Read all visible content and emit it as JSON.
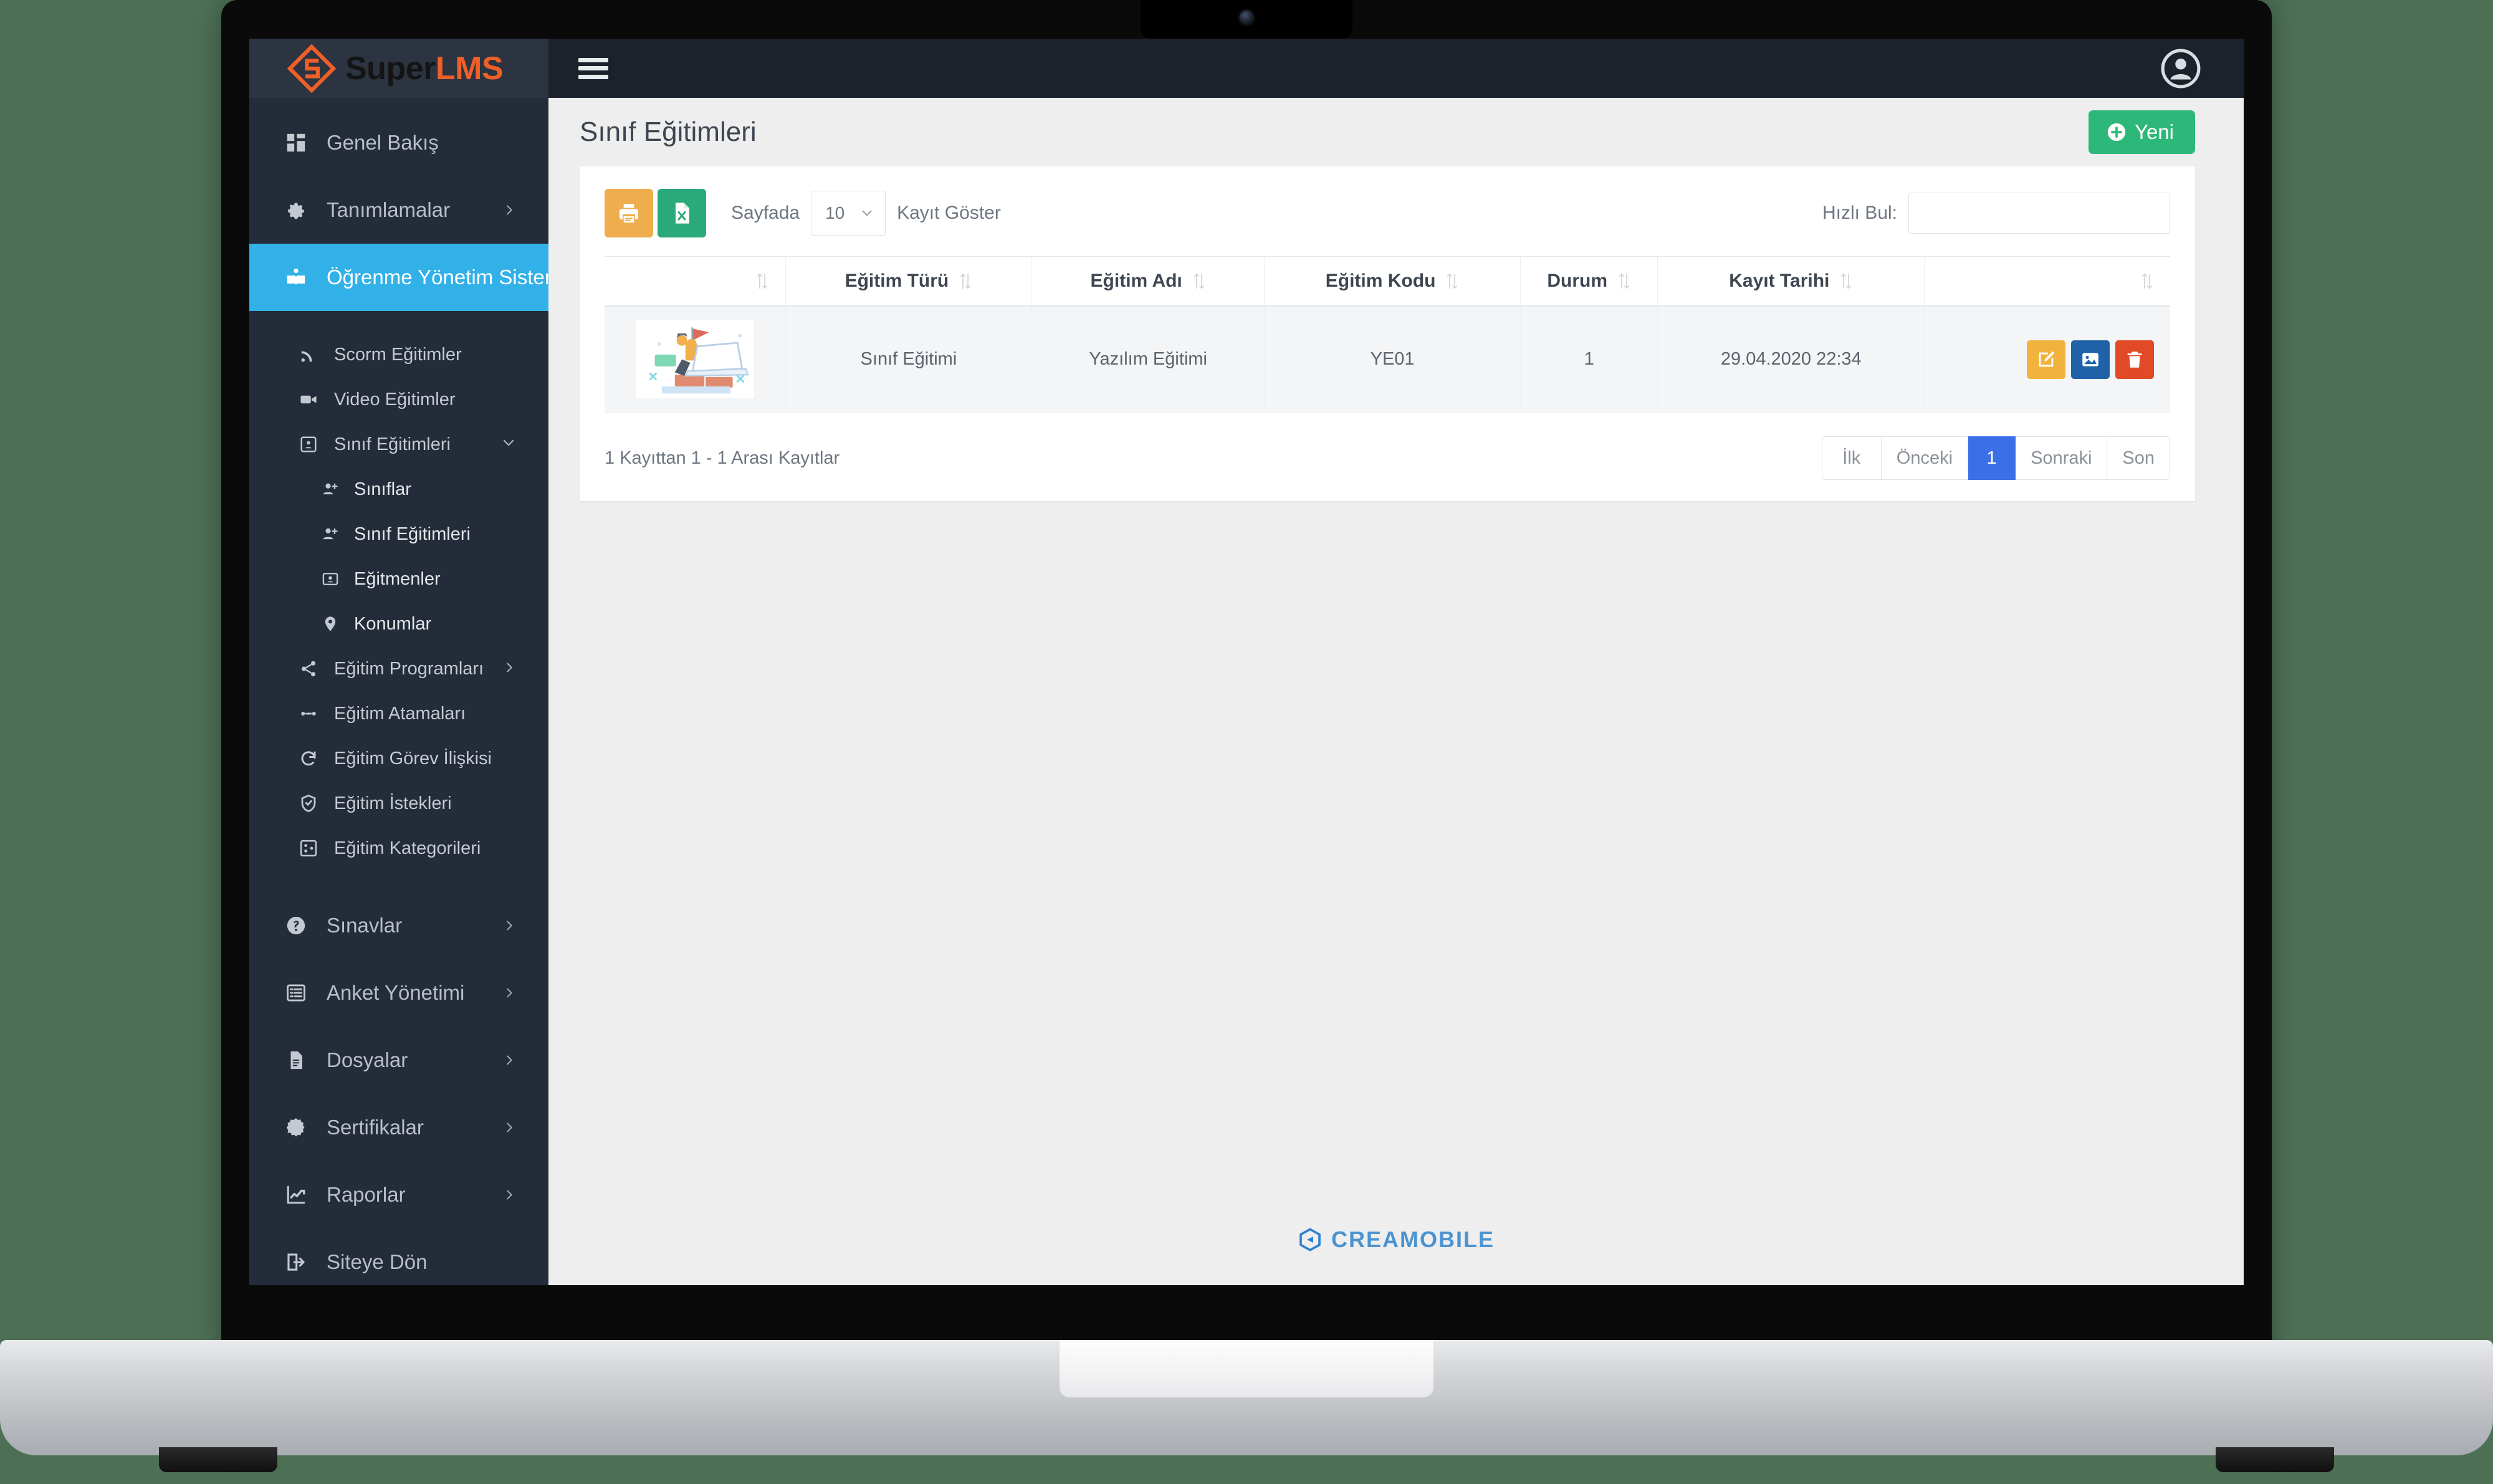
{
  "brand": {
    "name_dark": "Super",
    "name_accent": "LMS"
  },
  "topbar": {
    "menu_toggle": "menu-toggle",
    "account": "account"
  },
  "page": {
    "title": "Sınıf Eğitimleri",
    "new_button": "Yeni"
  },
  "toolbar": {
    "print_label": "print-export",
    "excel_label": "excel-export",
    "length_prefix": "Sayfada",
    "length_value": "10",
    "length_suffix": "Kayıt Göster",
    "search_label": "Hızlı Bul:",
    "search_value": ""
  },
  "table": {
    "columns": [
      "",
      "Eğitim Türü",
      "Eğitim Adı",
      "Eğitim Kodu",
      "Durum",
      "Kayıt Tarihi",
      ""
    ],
    "rows": [
      {
        "image": "course-illustration",
        "tur": "Sınıf Eğitimi",
        "adi": "Yazılım Eğitimi",
        "kodu": "YE01",
        "durum": "1",
        "tarih": "29.04.2020 22:34",
        "actions": [
          "edit",
          "image",
          "delete"
        ]
      }
    ]
  },
  "footer_info": "1 Kayıttan 1 - 1 Arası Kayıtlar",
  "pagination": {
    "first": "İlk",
    "prev": "Önceki",
    "pages": [
      "1"
    ],
    "next": "Sonraki",
    "last": "Son",
    "current": "1"
  },
  "site_footer": {
    "brand": "CREAMOBILE"
  },
  "sidebar": {
    "items": [
      {
        "label": "Genel Bakış",
        "icon": "dashboard-icon",
        "level": 0,
        "caret": "",
        "active": false
      },
      {
        "label": "Tanımlamalar",
        "icon": "gear-icon",
        "level": 0,
        "caret": "right",
        "active": false
      },
      {
        "label": "Öğrenme Yönetim Sistemi",
        "icon": "book-icon",
        "level": 0,
        "caret": "down",
        "active": true
      },
      {
        "label": "Scorm Eğitimler",
        "icon": "rss-icon",
        "level": 1,
        "caret": "",
        "active": false
      },
      {
        "label": "Video Eğitimler",
        "icon": "video-icon",
        "level": 1,
        "caret": "",
        "active": false
      },
      {
        "label": "Sınıf Eğitimleri",
        "icon": "classroom-icon",
        "level": 1,
        "caret": "down",
        "active": false
      },
      {
        "label": "Sınıflar",
        "icon": "user-add-icon",
        "level": 2,
        "caret": "",
        "active": false
      },
      {
        "label": "Sınıf Eğitimleri",
        "icon": "user-add-icon",
        "level": 2,
        "caret": "",
        "active": false
      },
      {
        "label": "Eğitmenler",
        "icon": "id-card-icon",
        "level": 2,
        "caret": "",
        "active": false
      },
      {
        "label": "Konumlar",
        "icon": "map-pin-icon",
        "level": 2,
        "caret": "",
        "active": false
      },
      {
        "label": "Eğitim Programları",
        "icon": "share-icon",
        "level": 1,
        "caret": "right",
        "active": false
      },
      {
        "label": "Eğitim Atamaları",
        "icon": "assign-icon",
        "level": 1,
        "caret": "",
        "active": false
      },
      {
        "label": "Eğitim Görev İlişkisi",
        "icon": "refresh-icon",
        "level": 1,
        "caret": "",
        "active": false
      },
      {
        "label": "Eğitim İstekleri",
        "icon": "shield-icon",
        "level": 1,
        "caret": "",
        "active": false
      },
      {
        "label": "Eğitim Kategorileri",
        "icon": "category-icon",
        "level": 1,
        "caret": "",
        "active": false
      },
      {
        "label": "Sınavlar",
        "icon": "question-icon",
        "level": 0,
        "caret": "right",
        "active": false
      },
      {
        "label": "Anket Yönetimi",
        "icon": "list-icon",
        "level": 0,
        "caret": "right",
        "active": false
      },
      {
        "label": "Dosyalar",
        "icon": "file-icon",
        "level": 0,
        "caret": "right",
        "active": false
      },
      {
        "label": "Sertifikalar",
        "icon": "badge-icon",
        "level": 0,
        "caret": "right",
        "active": false
      },
      {
        "label": "Raporlar",
        "icon": "chart-icon",
        "level": 0,
        "caret": "right",
        "active": false
      },
      {
        "label": "Siteye Dön",
        "icon": "logout-icon",
        "level": 0,
        "caret": "",
        "active": false
      }
    ]
  },
  "colors": {
    "accent_orange": "#ef5f28",
    "sidebar_bg": "#232c38",
    "active_blue": "#32b1e9",
    "new_green": "#2db87a",
    "pager_blue": "#3b6fe8"
  }
}
